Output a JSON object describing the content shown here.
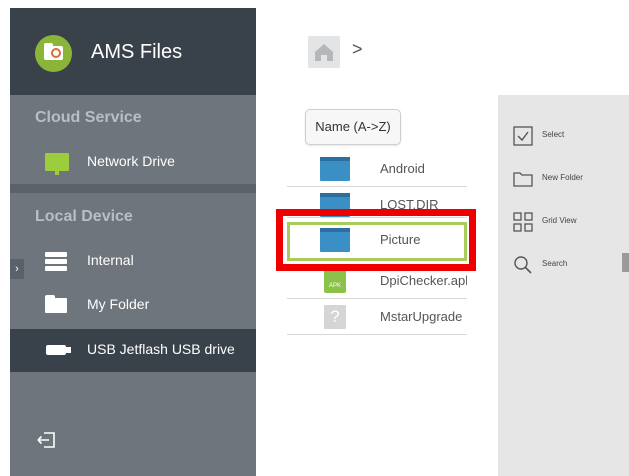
{
  "app": {
    "title": "AMS Files"
  },
  "sidebar": {
    "sections": [
      {
        "label": "Cloud Service"
      },
      {
        "label": "Local Device"
      }
    ],
    "items": [
      {
        "label": "Network Drive",
        "icon": "network-drive-icon"
      },
      {
        "label": "Internal",
        "icon": "internal-storage-icon"
      },
      {
        "label": "My Folder",
        "icon": "folder-icon"
      },
      {
        "label": "USB Jetflash USB drive",
        "icon": "usb-drive-icon",
        "active": true
      }
    ],
    "expand_glyph": "›"
  },
  "breadcrumb": {
    "home_icon": "home-icon",
    "separator": ">"
  },
  "sort": {
    "label": "Name (A->Z)"
  },
  "files": [
    {
      "name": "Android",
      "type": "folder"
    },
    {
      "name": "LOST.DIR",
      "type": "folder"
    },
    {
      "name": "Picture",
      "type": "folder",
      "selected": true
    },
    {
      "name": "DpiChecker.apk",
      "type": "apk",
      "badge": "APK"
    },
    {
      "name": "MstarUpgrade",
      "type": "unknown",
      "badge": "?"
    }
  ],
  "actions": [
    {
      "label": "Select",
      "icon": "checkbox-icon"
    },
    {
      "label": "New Folder",
      "icon": "new-folder-icon"
    },
    {
      "label": "Grid View",
      "icon": "grid-view-icon"
    },
    {
      "label": "Search",
      "icon": "search-icon"
    }
  ],
  "colors": {
    "sidebar_dark": "#39424a",
    "sidebar": "#6f757c",
    "accent_green": "#8bc34a",
    "folder_blue": "#3a8fc4",
    "highlight_red": "#ee0000"
  }
}
